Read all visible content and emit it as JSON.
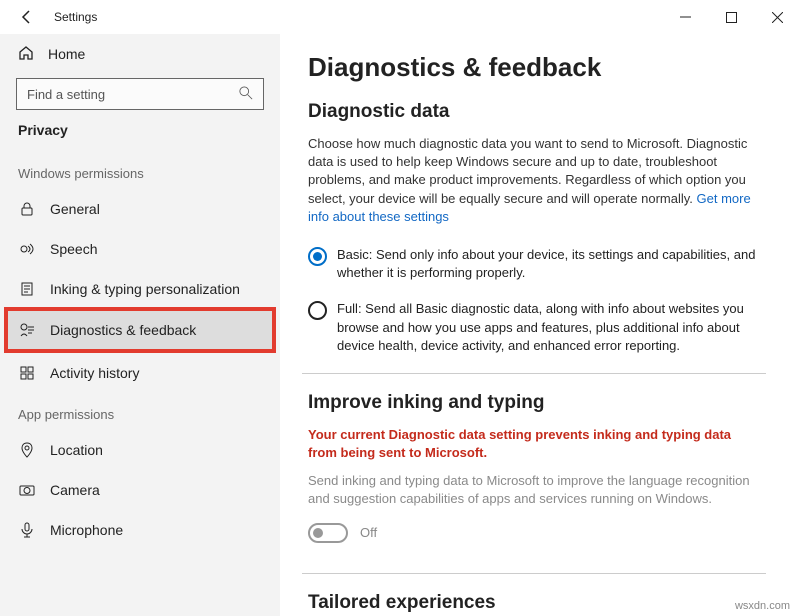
{
  "titlebar": {
    "title": "Settings"
  },
  "sidebar": {
    "home": "Home",
    "search_placeholder": "Find a setting",
    "current_section": "Privacy",
    "group_a": "Windows permissions",
    "group_b": "App permissions",
    "items_a": [
      {
        "label": "General"
      },
      {
        "label": "Speech"
      },
      {
        "label": "Inking & typing personalization"
      },
      {
        "label": "Diagnostics & feedback"
      },
      {
        "label": "Activity history"
      }
    ],
    "items_b": [
      {
        "label": "Location"
      },
      {
        "label": "Camera"
      },
      {
        "label": "Microphone"
      }
    ]
  },
  "main": {
    "heading": "Diagnostics & feedback",
    "diag_heading": "Diagnostic data",
    "diag_desc": "Choose how much diagnostic data you want to send to Microsoft. Diagnostic data is used to help keep Windows secure and up to date, troubleshoot problems, and make product improvements. Regardless of which option you select, your device will be equally secure and will operate normally. ",
    "diag_link": "Get more info about these settings",
    "radio_basic": "Basic: Send only info about your device, its settings and capabilities, and whether it is performing properly.",
    "radio_full": "Full: Send all Basic diagnostic data, along with info about websites you browse and how you use apps and features, plus additional info about device health, device activity, and enhanced error reporting.",
    "improve_heading": "Improve inking and typing",
    "improve_warn": "Your current Diagnostic data setting prevents inking and typing data from being sent to Microsoft.",
    "improve_desc": "Send inking and typing data to Microsoft to improve the language recognition and suggestion capabilities of apps and services running on Windows.",
    "toggle_label": "Off",
    "tailored_heading": "Tailored experiences"
  },
  "watermark": "wsxdn.com"
}
